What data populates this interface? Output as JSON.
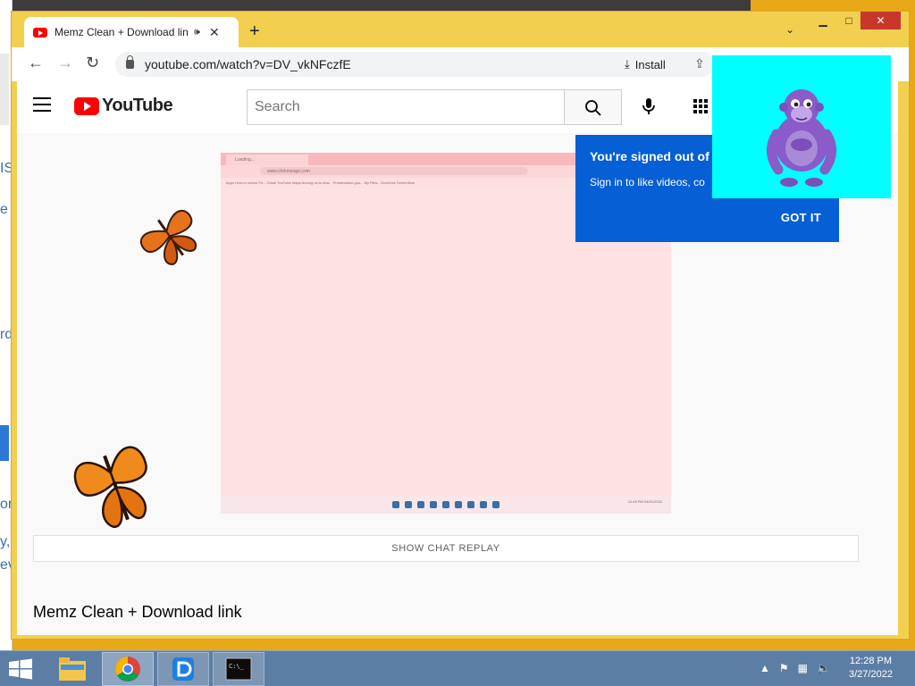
{
  "background": {
    "left_fragments": [
      "IS",
      "e",
      "rd",
      "or",
      "y,",
      "ev"
    ]
  },
  "browser": {
    "tab": {
      "title": "Memz Clean + Download lin",
      "audio_icon": "speaker-icon",
      "close_icon": "close-icon"
    },
    "new_tab_label": "+",
    "window_controls": {
      "minimize": "▁",
      "maximize": "□",
      "close": "✕"
    },
    "address_bar": {
      "url": "youtube.com/watch?v=DV_vkNFczfE"
    },
    "install_label": "Install"
  },
  "youtube": {
    "logo_text": "YouTube",
    "search": {
      "placeholder": "Search",
      "value": ""
    },
    "chat_replay_label": "SHOW CHAT REPLAY",
    "video_title": "Memz Clean + Download link",
    "signin_popup": {
      "title": "You're signed out of",
      "body": "Sign in to like videos, co",
      "button": "GOT IT"
    },
    "embedded_screen": {
      "tab_label": "Loading...",
      "url": "www.clickmeogo.com",
      "bookmarks": "Apps   How to unlock Fo...   Gmail   YouTube   Maps   Among us to dow...   Presentation-goo...   My Files - OneDrive   Screenflow",
      "clock": "12:49 PM\n04/01/2022"
    }
  },
  "taskbar": {
    "apps": [
      "file-explorer-icon",
      "chrome-icon",
      "blue-app-icon",
      "cmd-icon"
    ],
    "clock": {
      "time": "12:28 PM",
      "date": "3/27/2022"
    }
  },
  "colors": {
    "chrome_frame": "#f3cf4f",
    "youtube_red": "#ff0000",
    "popup_blue": "#065fd4",
    "bonzi_bg": "#00ffff",
    "taskbar": "#5c7ea5"
  }
}
